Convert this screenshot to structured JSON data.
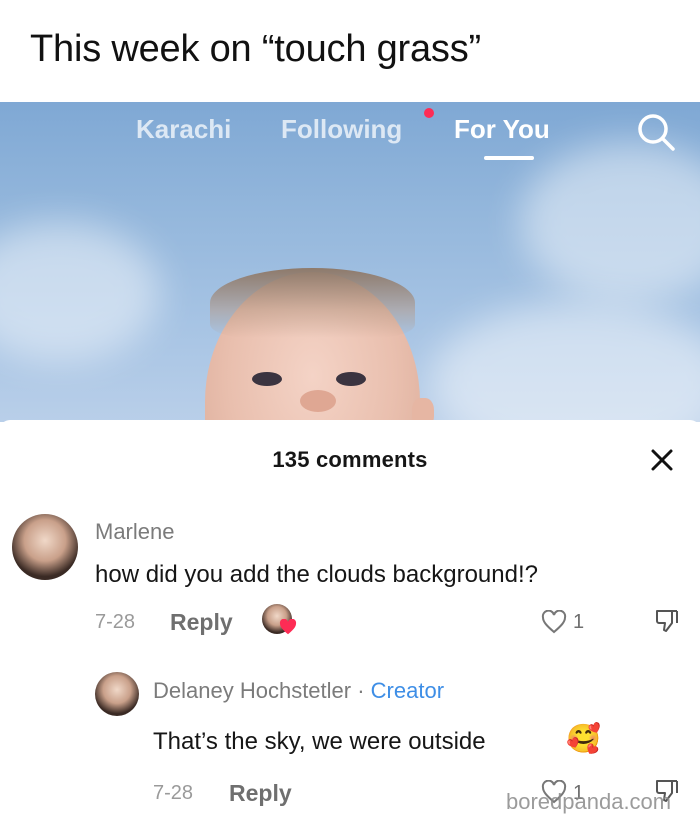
{
  "caption": "This week on “touch grass”",
  "nav": {
    "tabs": [
      {
        "label": "Karachi"
      },
      {
        "label": "Following",
        "has_dot": true
      },
      {
        "label": "For You",
        "active": true
      }
    ],
    "search_icon": "search-icon"
  },
  "comments_panel": {
    "count_label": "135 comments",
    "close_icon": "close-icon",
    "comments": [
      {
        "username": "Marlene",
        "text": "how did you add the clouds background!?",
        "date": "7-28",
        "reply_label": "Reply",
        "likes": "1",
        "liked_by_creator": true
      }
    ],
    "replies": [
      {
        "username": "Delaney Hochstetler",
        "separator": " · ",
        "badge": "Creator",
        "text": "That’s the sky, we were outside",
        "emoji": "🥰",
        "date": "7-28",
        "reply_label": "Reply",
        "likes": "1"
      }
    ]
  },
  "watermark": "boredpanda.com",
  "colors": {
    "accent_red": "#fe2c55",
    "creator_blue": "#3e8ee6",
    "sky": "#94b7dc"
  }
}
